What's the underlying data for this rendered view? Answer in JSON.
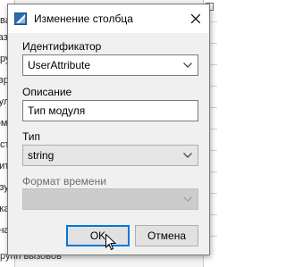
{
  "background": {
    "left_rows": [
      "ва",
      "азж",
      "ру",
      "вре",
      "уль",
      "омм",
      "ст",
      "ить",
      "зул",
      "кач",
      "нач"
    ],
    "bottom_text": "рупп вызовов"
  },
  "dialog": {
    "title": "Изменение столбца",
    "identifier": {
      "label": "Идентификатор",
      "value": "UserAttribute"
    },
    "description": {
      "label": "Описание",
      "value": "Тип модуля"
    },
    "type": {
      "label": "Тип",
      "value": "string"
    },
    "time_format": {
      "label": "Формат времени",
      "value": ""
    },
    "ok_label": "OK",
    "cancel_label": "Отмена"
  },
  "colors": {
    "default_button_border": "#0078d7",
    "dialog_bg": "#f0f0f0",
    "app_icon": "#2d6cb0"
  },
  "icons": {
    "title": "app-icon",
    "close": "close-icon",
    "dropdown": "chevron-down-icon",
    "pointer": "mouse-pointer-icon"
  }
}
